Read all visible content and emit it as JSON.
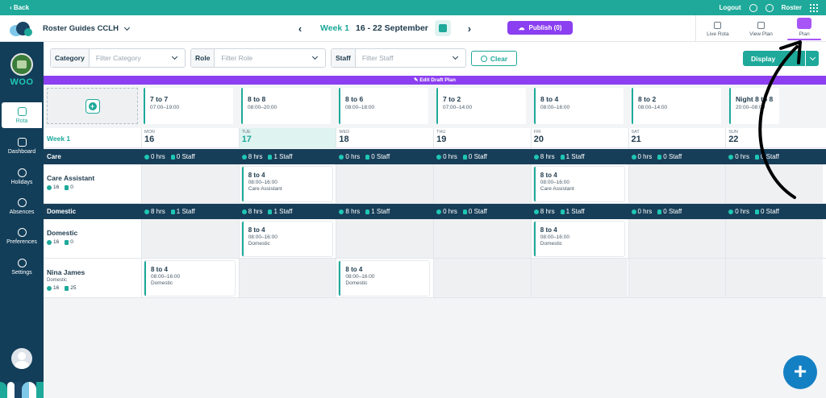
{
  "topbar": {
    "back": "‹ Back",
    "logout": "Logout",
    "user": "Roster"
  },
  "header": {
    "org": "Roster Guides CCLH",
    "week_label": "Week 1",
    "date_range": "16 - 22 September",
    "publish": "Publish (0)",
    "views": [
      {
        "label": "Live Rota",
        "icon": "clock-icon"
      },
      {
        "label": "View Plan",
        "icon": "briefcase-icon"
      },
      {
        "label": "Plan",
        "icon": "pencil-icon"
      }
    ]
  },
  "sidebar": {
    "org_short": "WOO",
    "items": [
      {
        "label": "Rota",
        "icon": "calendar-icon"
      },
      {
        "label": "Dashboard",
        "icon": "dashboard-icon"
      },
      {
        "label": "Holidays",
        "icon": "plane-icon"
      },
      {
        "label": "Absences",
        "icon": "absence-icon"
      },
      {
        "label": "Preferences",
        "icon": "user-gear-icon"
      },
      {
        "label": "Settings",
        "icon": "gear-icon"
      }
    ]
  },
  "filters": [
    {
      "label": "Category",
      "placeholder": "Filter Category"
    },
    {
      "label": "Role",
      "placeholder": "Filter Role"
    },
    {
      "label": "Staff",
      "placeholder": "Filter Staff"
    }
  ],
  "clear": "Clear",
  "display": "Display",
  "draft_bar": "✎ Edit Draft Plan",
  "shift_templates": [
    {
      "title": "7 to 7",
      "time": "07:00–19:00"
    },
    {
      "title": "8 to 8",
      "time": "08:00–20:00"
    },
    {
      "title": "8 to 6",
      "time": "08:00–18:00"
    },
    {
      "title": "7 to 2",
      "time": "07:00–14:00"
    },
    {
      "title": "8 to 4",
      "time": "08:00–16:00"
    },
    {
      "title": "8 to 2",
      "time": "08:00–14:00"
    },
    {
      "title": "Night 8 to 8",
      "time": "20:00–08:00"
    }
  ],
  "week_title": "Week 1",
  "days": [
    {
      "name": "MON",
      "date": "16"
    },
    {
      "name": "TUE",
      "date": "17"
    },
    {
      "name": "WED",
      "date": "18"
    },
    {
      "name": "THU",
      "date": "19"
    },
    {
      "name": "FRI",
      "date": "20"
    },
    {
      "name": "SAT",
      "date": "21"
    },
    {
      "name": "SUN",
      "date": "22"
    }
  ],
  "groups": [
    {
      "name": "Care",
      "stats": [
        {
          "hrs": "0 hrs",
          "staff": "0 Staff"
        },
        {
          "hrs": "8 hrs",
          "staff": "1 Staff"
        },
        {
          "hrs": "0 hrs",
          "staff": "0 Staff"
        },
        {
          "hrs": "0 hrs",
          "staff": "0 Staff"
        },
        {
          "hrs": "8 hrs",
          "staff": "1 Staff"
        },
        {
          "hrs": "0 hrs",
          "staff": "0 Staff"
        },
        {
          "hrs": "0 hrs",
          "staff": "0 Staff"
        }
      ]
    },
    {
      "name": "Domestic",
      "stats": [
        {
          "hrs": "8 hrs",
          "staff": "1 Staff"
        },
        {
          "hrs": "8 hrs",
          "staff": "1 Staff"
        },
        {
          "hrs": "8 hrs",
          "staff": "1 Staff"
        },
        {
          "hrs": "0 hrs",
          "staff": "0 Staff"
        },
        {
          "hrs": "8 hrs",
          "staff": "1 Staff"
        },
        {
          "hrs": "0 hrs",
          "staff": "0 Staff"
        },
        {
          "hrs": "0 hrs",
          "staff": "0 Staff"
        }
      ]
    }
  ],
  "rows": [
    {
      "name": "Care Assistant",
      "role": "",
      "metric1": "16",
      "metric2": "0",
      "shifts": [
        null,
        {
          "title": "8 to 4",
          "time": "08:00–16:00",
          "role": "Care Assistant"
        },
        null,
        null,
        {
          "title": "8 to 4",
          "time": "08:00–16:00",
          "role": "Care Assistant"
        },
        null,
        null
      ]
    },
    {
      "name": "Domestic",
      "role": "",
      "metric1": "16",
      "metric2": "0",
      "shifts": [
        null,
        {
          "title": "8 to 4",
          "time": "08:00–16:00",
          "role": "Domestic"
        },
        null,
        null,
        {
          "title": "8 to 4",
          "time": "08:00–16:00",
          "role": "Domestic"
        },
        null,
        null
      ]
    },
    {
      "name": "Nina James",
      "role": "Domestic",
      "metric1": "16",
      "metric2": "25",
      "shifts": [
        {
          "title": "8 to 4",
          "time": "08:00–16:00",
          "role": "Domestic"
        },
        null,
        {
          "title": "8 to 4",
          "time": "08:00–16:00",
          "role": "Domestic"
        },
        null,
        null,
        null,
        null
      ]
    }
  ],
  "fab": "+",
  "colors": {
    "teal": "#1ea99a",
    "navy": "#133e59",
    "purple": "#8b3ff0",
    "fab_blue": "#1480c4"
  }
}
